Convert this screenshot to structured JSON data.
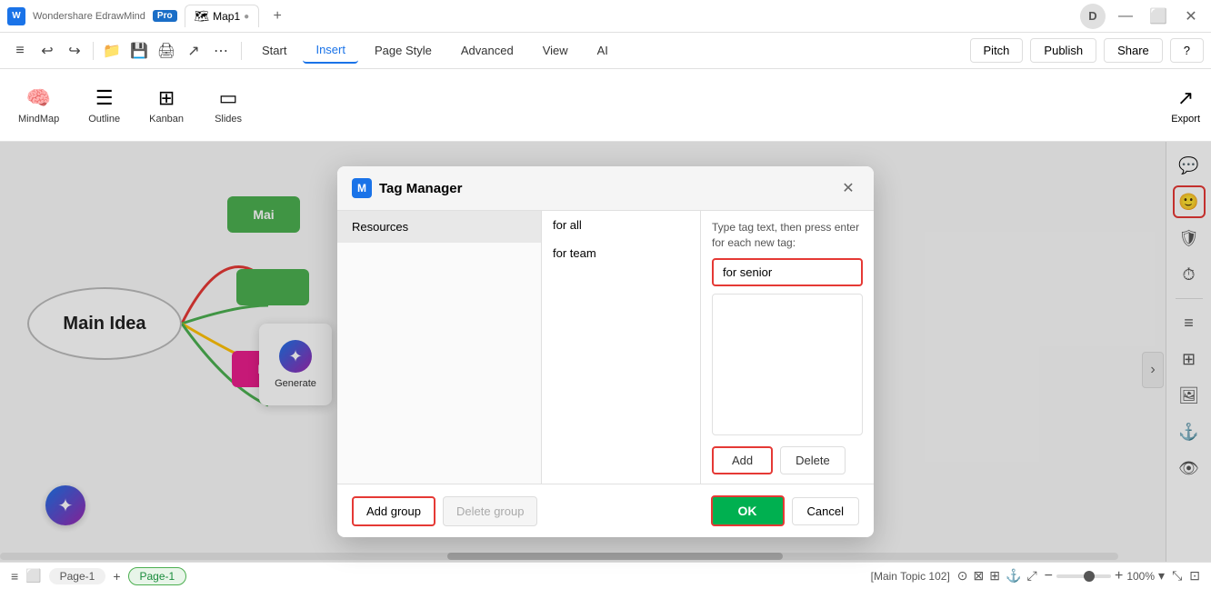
{
  "app": {
    "logo": "W",
    "brand": "Wondershare EdrawMind",
    "badge": "Pro"
  },
  "tabs": [
    {
      "id": "edrawmind-tab",
      "icon": "🧠",
      "label": "Map1",
      "dot": true
    },
    {
      "id": "add-tab",
      "icon": "+",
      "label": ""
    }
  ],
  "window_controls": {
    "minimize": "—",
    "maximize": "⬜",
    "close": "✕",
    "user": "D"
  },
  "menu": {
    "items": [
      {
        "id": "collapse",
        "icon": "≡",
        "label": ""
      },
      {
        "id": "undo",
        "icon": "↩",
        "label": ""
      },
      {
        "id": "redo",
        "icon": "↪",
        "label": ""
      },
      {
        "id": "open",
        "icon": "📂",
        "label": ""
      },
      {
        "id": "save",
        "icon": "💾",
        "label": ""
      },
      {
        "id": "print",
        "icon": "🖨",
        "label": ""
      },
      {
        "id": "export2",
        "icon": "📤",
        "label": ""
      },
      {
        "id": "more",
        "icon": "⋯",
        "label": ""
      }
    ],
    "tabs": [
      "Start",
      "Insert",
      "Page Style",
      "Advanced",
      "View",
      "AI"
    ],
    "active_tab": "Insert",
    "right_buttons": {
      "pitch": "Pitch",
      "publish": "Publish",
      "share": "Share",
      "help": "?"
    }
  },
  "ribbon": {
    "items": [
      {
        "id": "mindmap",
        "icon": "🧠",
        "label": "MindMap"
      },
      {
        "id": "outline",
        "icon": "☰",
        "label": "Outline"
      },
      {
        "id": "kanban",
        "icon": "⊞",
        "label": "Kanban"
      },
      {
        "id": "slides",
        "icon": "▭",
        "label": "Slides"
      }
    ]
  },
  "canvas": {
    "main_idea_label": "Main Idea",
    "branches": [
      "Mai",
      "Mai"
    ],
    "ai_popup_label": "Generate"
  },
  "right_panel": {
    "buttons": [
      {
        "id": "comment",
        "icon": "💬",
        "active": false
      },
      {
        "id": "emoji",
        "icon": "🙂",
        "active": true
      },
      {
        "id": "shield",
        "icon": "🛡",
        "active": false
      },
      {
        "id": "clock",
        "icon": "⏱",
        "active": false
      },
      {
        "id": "list",
        "icon": "≡",
        "active": false
      },
      {
        "id": "grid",
        "icon": "⊞",
        "active": false
      },
      {
        "id": "image",
        "icon": "🖼",
        "active": false
      },
      {
        "id": "anchor",
        "icon": "⚓",
        "active": false
      },
      {
        "id": "eye",
        "icon": "👁",
        "active": false
      }
    ]
  },
  "modal": {
    "title": "Tag Manager",
    "logo": "M",
    "groups": [
      {
        "id": "resources",
        "label": "Resources",
        "active": true
      }
    ],
    "tags": [
      {
        "id": "for-all",
        "label": "for all"
      },
      {
        "id": "for-team",
        "label": "for team"
      }
    ],
    "hint": "Type tag text, then press enter for each new tag:",
    "tag_input_value": "for senior",
    "buttons": {
      "add": "Add",
      "delete": "Delete",
      "add_group": "Add group",
      "delete_group": "Delete group",
      "ok": "OK",
      "cancel": "Cancel"
    }
  },
  "status_bar": {
    "icons": [
      "≡",
      "⬜",
      "+"
    ],
    "page_label": "Page-1",
    "page_tab": "Page-1",
    "status_text": "[Main Topic 102]",
    "zoom_level": "100%",
    "zoom_minus": "−",
    "zoom_plus": "+"
  },
  "export_label": "Export"
}
